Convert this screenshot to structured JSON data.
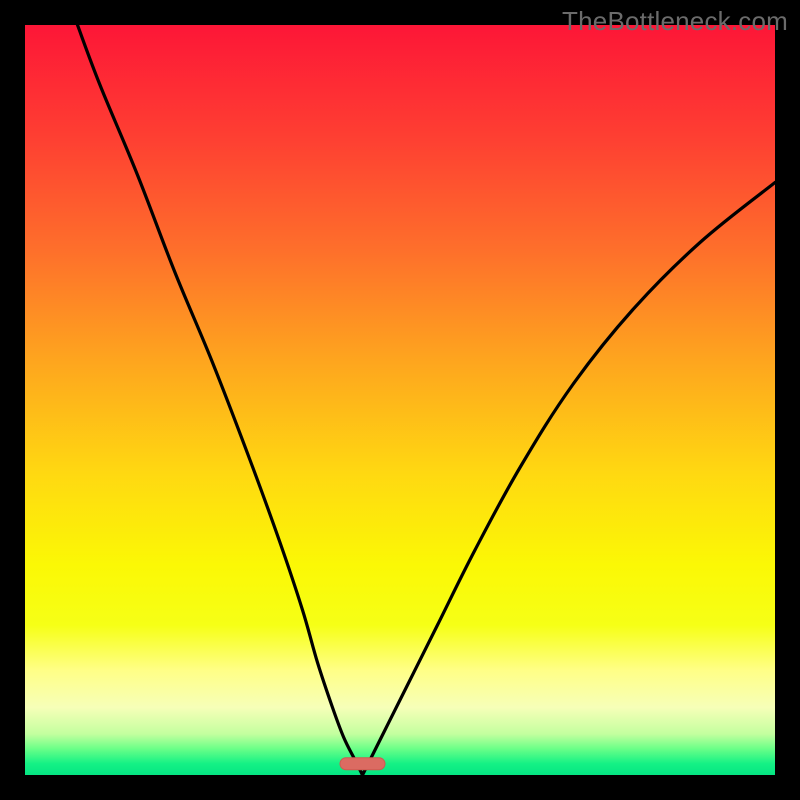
{
  "watermark": "TheBottleneck.com",
  "colors": {
    "background": "#000000",
    "gradient_stops": [
      {
        "offset": 0.0,
        "color": "#fd1637"
      },
      {
        "offset": 0.15,
        "color": "#fe3f32"
      },
      {
        "offset": 0.3,
        "color": "#fe6f2b"
      },
      {
        "offset": 0.45,
        "color": "#fea61e"
      },
      {
        "offset": 0.6,
        "color": "#ffd911"
      },
      {
        "offset": 0.72,
        "color": "#fbf805"
      },
      {
        "offset": 0.8,
        "color": "#f6ff16"
      },
      {
        "offset": 0.86,
        "color": "#ffff86"
      },
      {
        "offset": 0.91,
        "color": "#f6ffb8"
      },
      {
        "offset": 0.945,
        "color": "#c4ff9f"
      },
      {
        "offset": 0.965,
        "color": "#6aff88"
      },
      {
        "offset": 0.985,
        "color": "#14f185"
      },
      {
        "offset": 1.0,
        "color": "#05e583"
      }
    ],
    "curve_stroke": "#000000",
    "marker_fill": "#db6b62",
    "marker_stroke": "#cf5a51"
  },
  "chart_data": {
    "type": "line",
    "title": "",
    "xlabel": "",
    "ylabel": "",
    "xlim": [
      0,
      100
    ],
    "ylim": [
      0,
      100
    ],
    "x_min_at_zero": 45,
    "marker": {
      "x_center": 45,
      "width_pct": 6,
      "height_pct": 1.6,
      "y_pct": 98.5
    },
    "series": [
      {
        "name": "left-branch",
        "x": [
          7,
          10,
          15,
          20,
          25,
          30,
          34,
          37,
          39,
          41,
          42.5,
          44,
          45
        ],
        "y": [
          100,
          92,
          80,
          67,
          55,
          42,
          31,
          22,
          15,
          9,
          5,
          2,
          0
        ]
      },
      {
        "name": "right-branch",
        "x": [
          45,
          46,
          48,
          51,
          55,
          60,
          66,
          73,
          81,
          90,
          100
        ],
        "y": [
          0,
          2,
          6,
          12,
          20,
          30,
          41,
          52,
          62,
          71,
          79
        ]
      }
    ]
  }
}
